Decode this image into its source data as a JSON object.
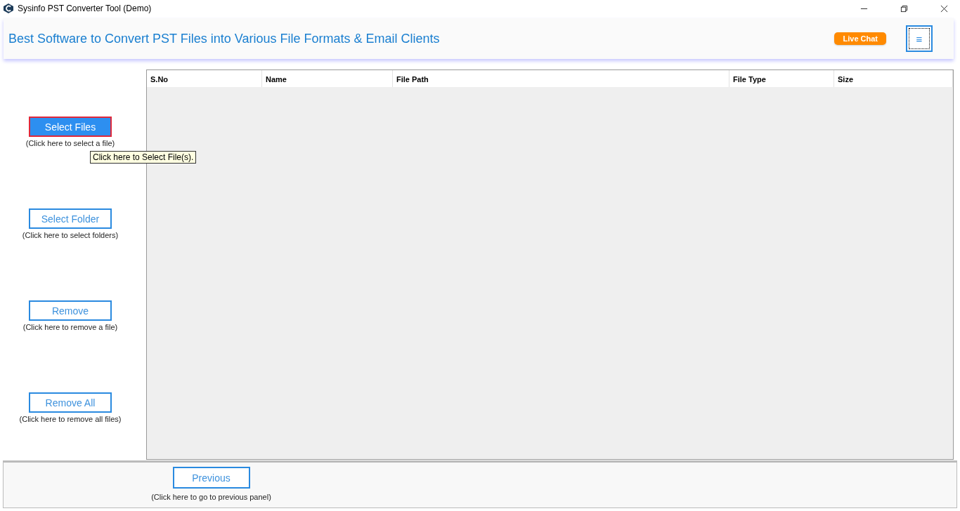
{
  "window": {
    "title": "Sysinfo PST Converter Tool (Demo)"
  },
  "header": {
    "headline": "Best Software to Convert PST Files into Various File Formats & Email Clients",
    "live_chat": "Live Chat",
    "menu": "≡"
  },
  "actions": [
    {
      "label": "Select Files",
      "hint": "(Click here to select a file)",
      "selected": true
    },
    {
      "label": "Select Folder",
      "hint": "(Click here to select folders)",
      "selected": false
    },
    {
      "label": "Remove",
      "hint": "(Click here to remove a file)",
      "selected": false
    },
    {
      "label": "Remove All",
      "hint": "(Click here to remove all files)",
      "selected": false
    }
  ],
  "tooltip": "Click here to Select File(s).",
  "table": {
    "columns": [
      "S.No",
      "Name",
      "File Path",
      "File Type",
      "Size"
    ]
  },
  "footer": {
    "label": "Previous",
    "hint": "(Click here to go to previous panel)"
  }
}
